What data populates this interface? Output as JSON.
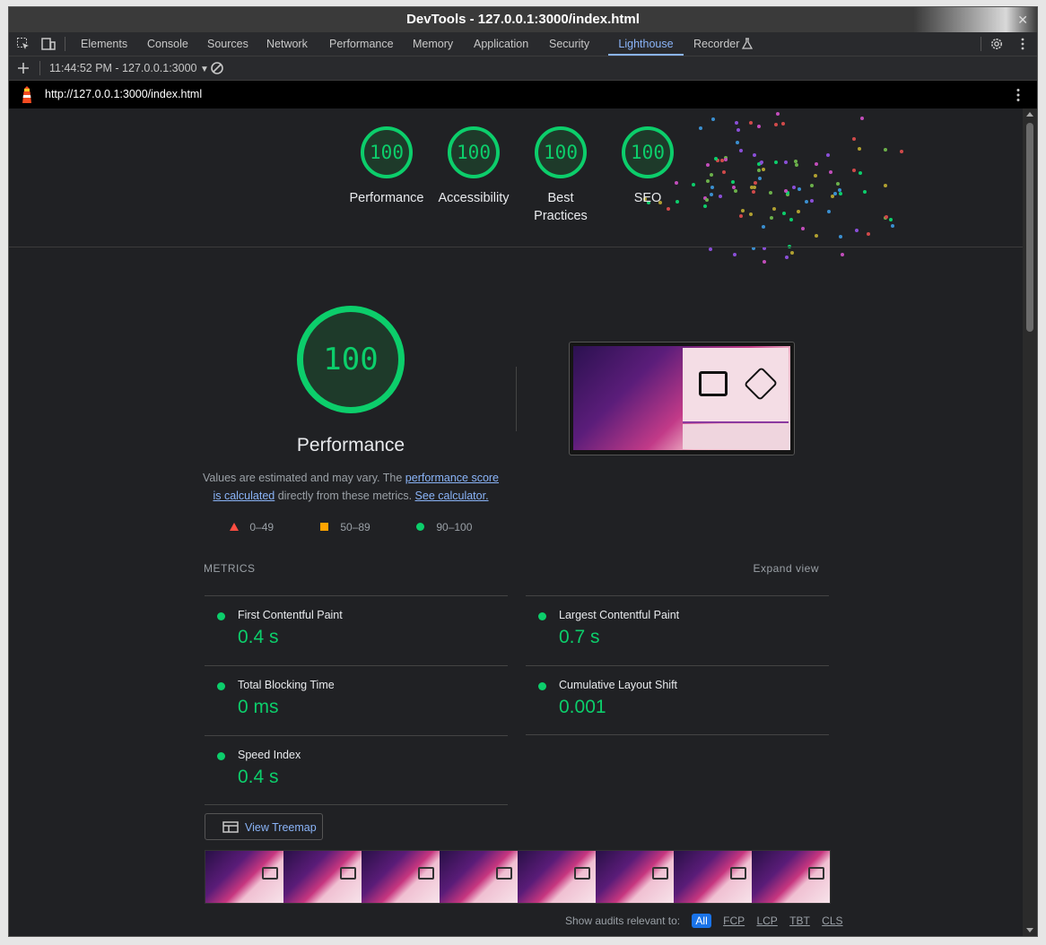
{
  "window": {
    "title": "DevTools - 127.0.0.1:3000/index.html",
    "close": "✕"
  },
  "tabs": [
    "Elements",
    "Console",
    "Sources",
    "Network",
    "Performance",
    "Memory",
    "Application",
    "Security",
    "Lighthouse",
    "Recorder"
  ],
  "active_tab": "Lighthouse",
  "subbar": {
    "report_selector": "11:44:52 PM - 127.0.0.1:3000"
  },
  "urlbar": {
    "url": "http://127.0.0.1:3000/index.html"
  },
  "categories": [
    {
      "score": "100",
      "label": "Performance"
    },
    {
      "score": "100",
      "label": "Accessibility"
    },
    {
      "score": "100",
      "label": "Best Practices"
    },
    {
      "score": "100",
      "label": "SEO"
    }
  ],
  "performance": {
    "score": "100",
    "title": "Performance",
    "desc_prefix": "Values are estimated and may vary. The ",
    "desc_link1": "performance score is calculated",
    "desc_mid": " directly from these metrics. ",
    "desc_link2": "See calculator."
  },
  "legend": {
    "fail": "0–49",
    "average": "50–89",
    "pass": "90–100"
  },
  "metrics_section": {
    "header": "METRICS",
    "expand": "Expand view"
  },
  "metrics": [
    {
      "name": "First Contentful Paint",
      "value": "0.4 s"
    },
    {
      "name": "Largest Contentful Paint",
      "value": "0.7 s"
    },
    {
      "name": "Total Blocking Time",
      "value": "0 ms"
    },
    {
      "name": "Cumulative Layout Shift",
      "value": "0.001"
    },
    {
      "name": "Speed Index",
      "value": "0.4 s"
    }
  ],
  "treemap_button": "View Treemap",
  "audits_filter": {
    "label": "Show audits relevant to:",
    "options": [
      "All",
      "FCP",
      "LCP",
      "TBT",
      "CLS"
    ],
    "selected": "All"
  },
  "colors": {
    "pass": "#0cce6b",
    "average": "#ffa400",
    "fail": "#ff4e42",
    "accent": "#8ab4f8"
  }
}
